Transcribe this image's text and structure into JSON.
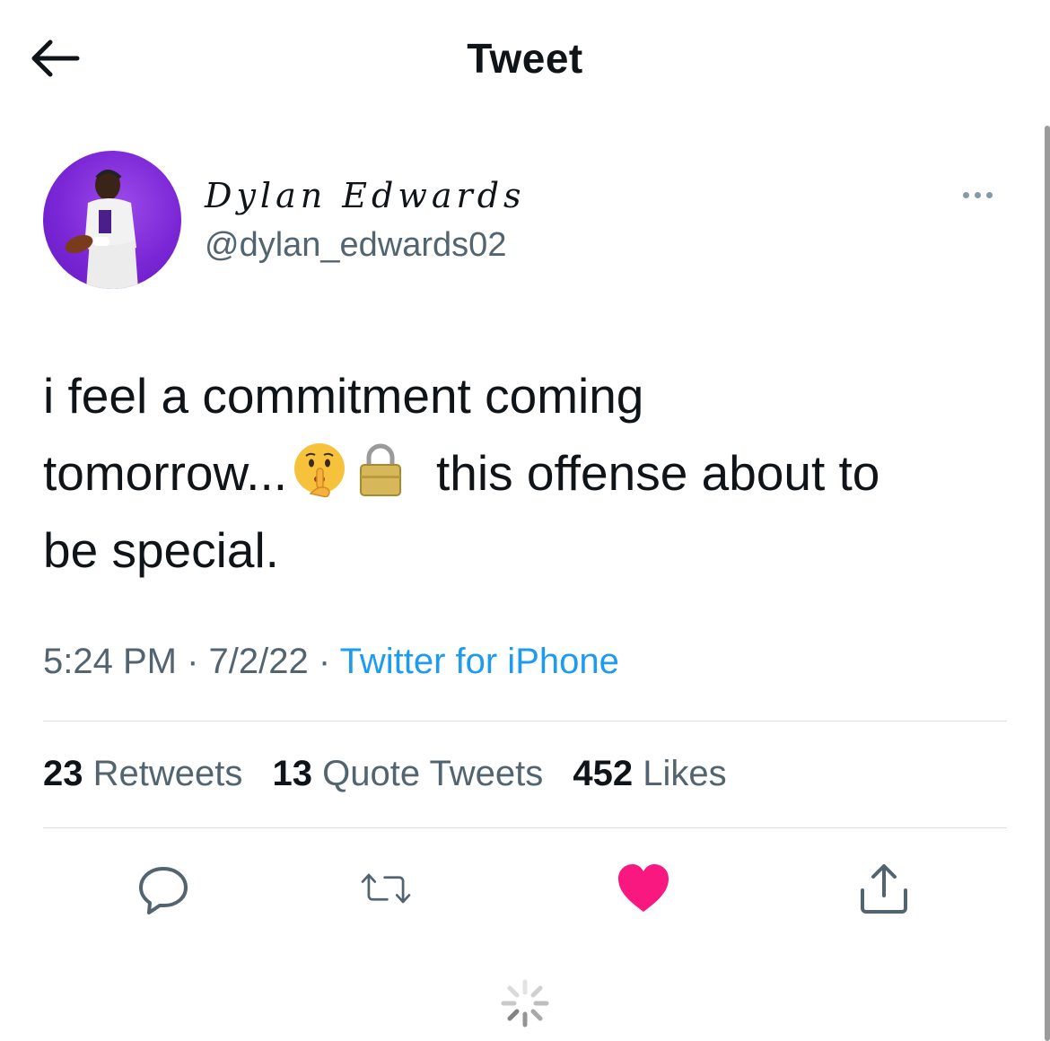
{
  "header": {
    "title": "Tweet",
    "back_icon": "arrow-left-icon"
  },
  "tweet": {
    "author": {
      "display_name": "Dylan Edwards",
      "handle": "@dylan_edwards02"
    },
    "text": {
      "part1": "i feel a commitment coming",
      "part2": "tomorrow...",
      "emoji1": "shushing-face-icon",
      "emoji2": "lock-icon",
      "part3": "this offense about to",
      "part4": "be special."
    },
    "time": "5:24 PM",
    "separator": "·",
    "date": "7/2/22",
    "source": "Twitter for iPhone",
    "stats": {
      "retweets_count": "23",
      "retweets_label": "Retweets",
      "quotes_count": "13",
      "quotes_label": "Quote Tweets",
      "likes_count": "452",
      "likes_label": "Likes"
    },
    "actions": {
      "reply": "reply-icon",
      "retweet": "retweet-icon",
      "like": "heart-icon",
      "share": "share-icon"
    },
    "liked": true
  },
  "colors": {
    "accent": "#1d9bf0",
    "like": "#f91880",
    "secondary_text": "#536471",
    "avatar_bg": "#7a26d6"
  }
}
